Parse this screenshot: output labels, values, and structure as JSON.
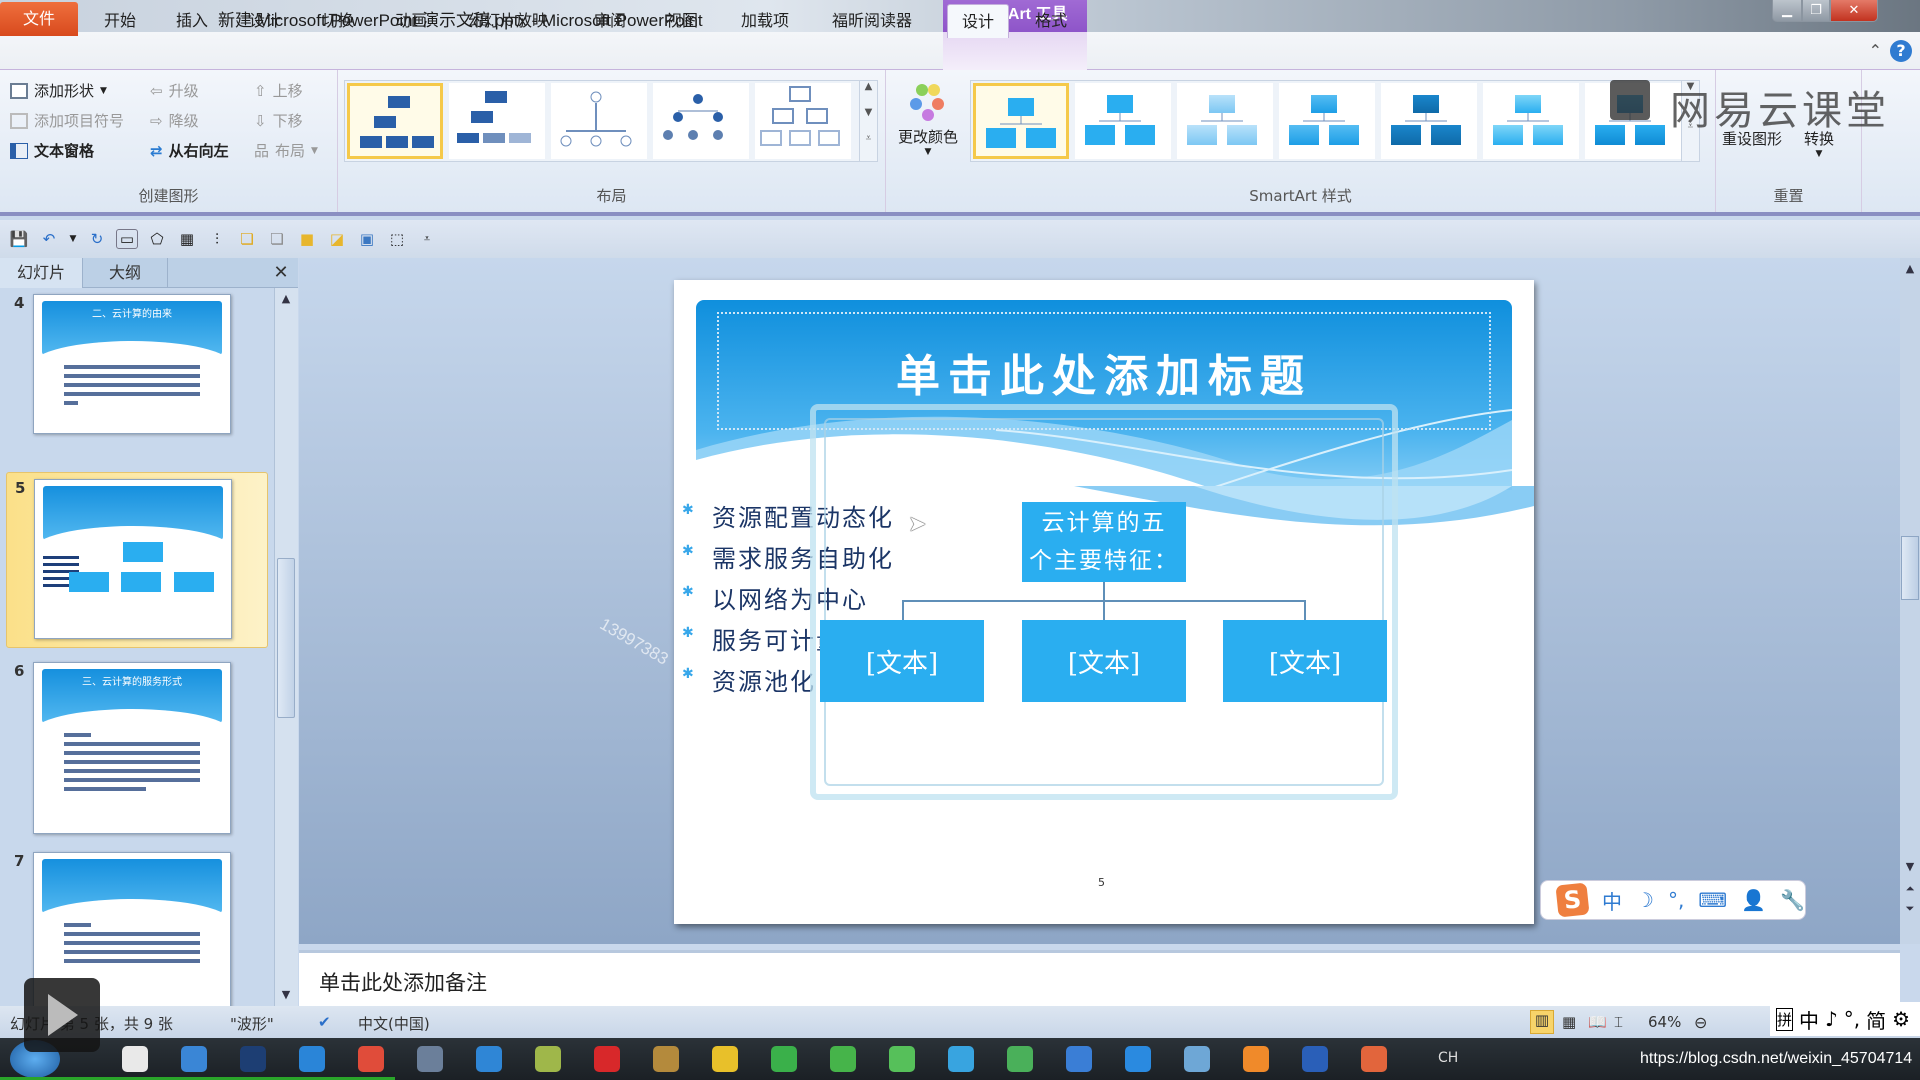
{
  "window": {
    "title": "新建 Microsoft PowerPoint 演示文稿.pptx - Microsoft PowerPoint",
    "context_tool": "SmartArt 工具",
    "app_icon": "P"
  },
  "tabs": [
    {
      "label": "文件",
      "active": false
    },
    {
      "label": "开始",
      "active": false
    },
    {
      "label": "插入",
      "active": false
    },
    {
      "label": "设计",
      "active": false
    },
    {
      "label": "切换",
      "active": false
    },
    {
      "label": "动画",
      "active": false
    },
    {
      "label": "幻灯片放映",
      "active": false
    },
    {
      "label": "审阅",
      "active": false
    },
    {
      "label": "视图",
      "active": false
    },
    {
      "label": "加载项",
      "active": false
    },
    {
      "label": "福昕阅读器",
      "active": false
    },
    {
      "label": "设计",
      "active": true,
      "context": true
    },
    {
      "label": "格式",
      "active": false,
      "context": true
    }
  ],
  "ribbon": {
    "create_graphic": {
      "label": "创建图形",
      "add_shape": "添加形状",
      "add_bullet": "添加项目符号",
      "text_pane": "文本窗格",
      "promote": "升级",
      "demote": "降级",
      "right_to_left": "从右向左",
      "move_up": "上移",
      "move_down": "下移",
      "layout": "布局"
    },
    "layouts": {
      "label": "布局",
      "selected_index": 0,
      "count": 5
    },
    "styles": {
      "label": "SmartArt 样式",
      "change_colors": "更改颜色",
      "selected_index": 0,
      "count": 7
    },
    "reset": {
      "label": "重置",
      "reset_graphic": "重设图形",
      "convert": "转换"
    }
  },
  "left_panel": {
    "tabs": [
      "幻灯片",
      "大纲"
    ],
    "thumbnails": [
      {
        "number": "4",
        "title": "二、云计算的由来",
        "selected": false
      },
      {
        "number": "5",
        "title": "",
        "selected": true
      },
      {
        "number": "6",
        "title": "三、云计算的服务形式",
        "selected": false
      },
      {
        "number": "7",
        "title": "",
        "selected": false
      }
    ]
  },
  "slide": {
    "title_placeholder": "单击此处添加标题",
    "bullets": [
      "资源配置动态化",
      "需求服务自助化",
      "以网络为中心",
      "服务可计量化",
      "资源池化"
    ],
    "smartart": {
      "root": "云计算的五个主要特征：",
      "children": [
        "[文本]",
        "[文本]",
        "[文本]"
      ]
    },
    "page_number": "5",
    "watermark": "13997383"
  },
  "notes": {
    "placeholder": "单击此处添加备注"
  },
  "status": {
    "slide_info": "幻灯片 第 5 张，共 9 张",
    "theme": "\"波形\"",
    "language": "中文(中国)",
    "zoom": "64%"
  },
  "ime": {
    "toolbar": [
      "中",
      "☽",
      "°,",
      "⌨",
      "👤",
      "🔧"
    ],
    "mini": [
      "拼",
      "中",
      "♪",
      "°,",
      "简",
      "⚙"
    ]
  },
  "taskbar": {
    "tray_lang": "CH",
    "url_text": "https://blog.csdn.net/weixin_45704714"
  },
  "brand_watermark": "网易云课堂"
}
